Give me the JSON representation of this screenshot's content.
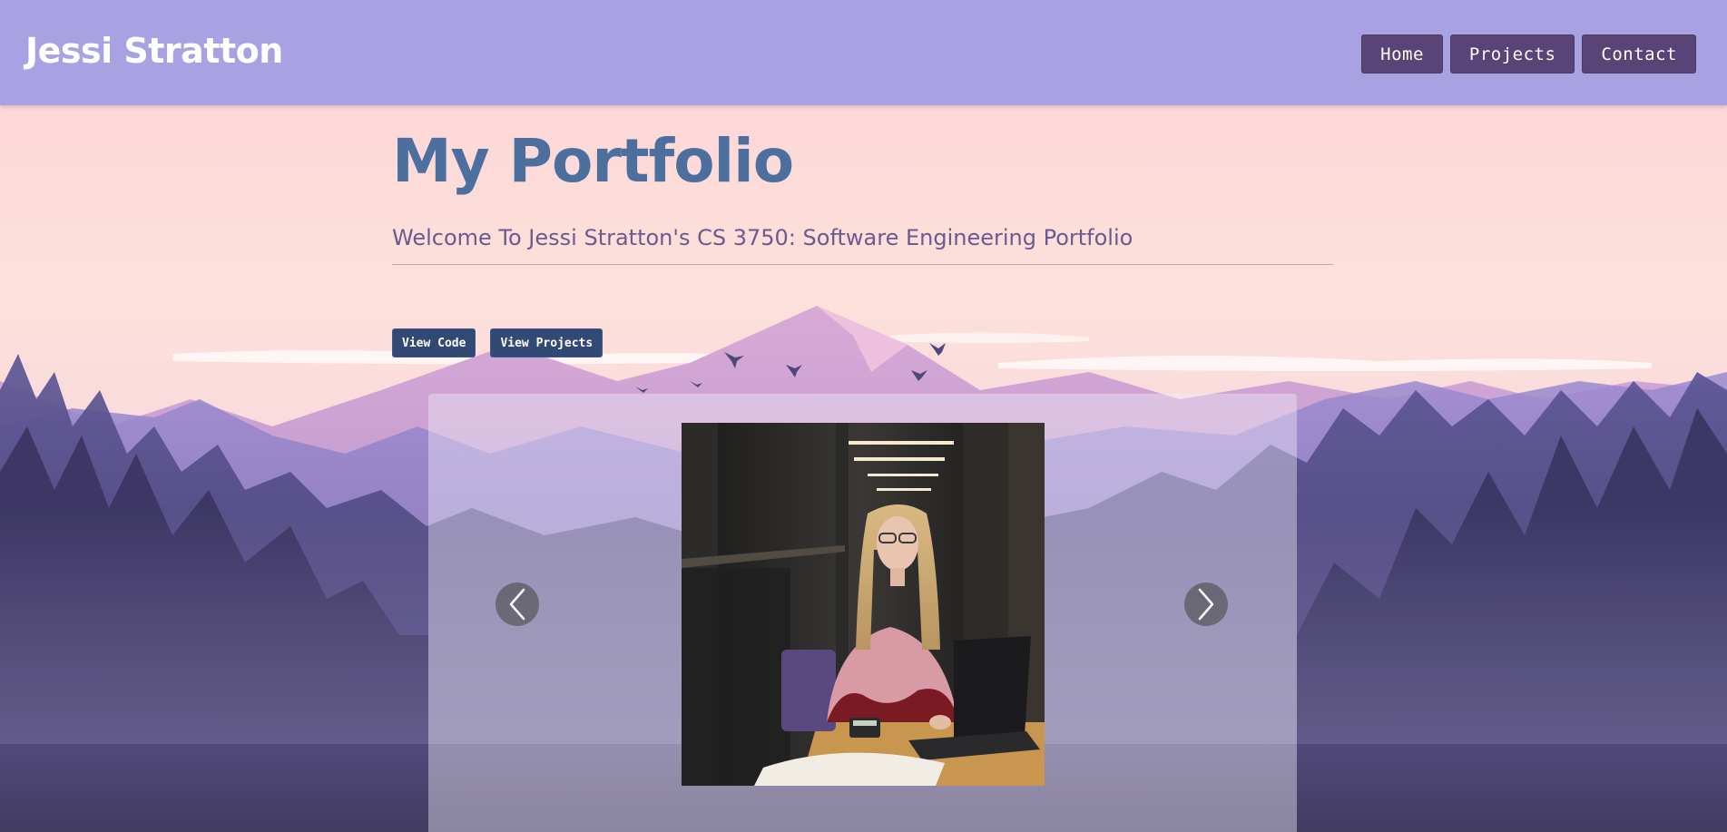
{
  "window": {
    "title": "Jessi Stratton"
  },
  "navbar": {
    "brand": "Jessi Stratton",
    "items": [
      {
        "label": "Home"
      },
      {
        "label": "Projects"
      },
      {
        "label": "Contact"
      }
    ]
  },
  "hero": {
    "title": "My Portfolio",
    "subtitle": "Welcome To Jessi Stratton's CS 3750: Software Engineering Portfolio",
    "buttons": {
      "view_code": "View Code",
      "view_projects": "View Projects"
    }
  },
  "carousel": {
    "prev_icon": "chevron-left-icon",
    "next_icon": "chevron-right-icon",
    "slide_image": "portrait photo of woman at laptop in library"
  },
  "colors": {
    "navbar_bg": "#a8a2e2",
    "nav_button_bg": "#584477",
    "title_color": "#4d6f9e",
    "subtitle_color": "#6c5a8f",
    "action_button_bg": "#324a73"
  }
}
